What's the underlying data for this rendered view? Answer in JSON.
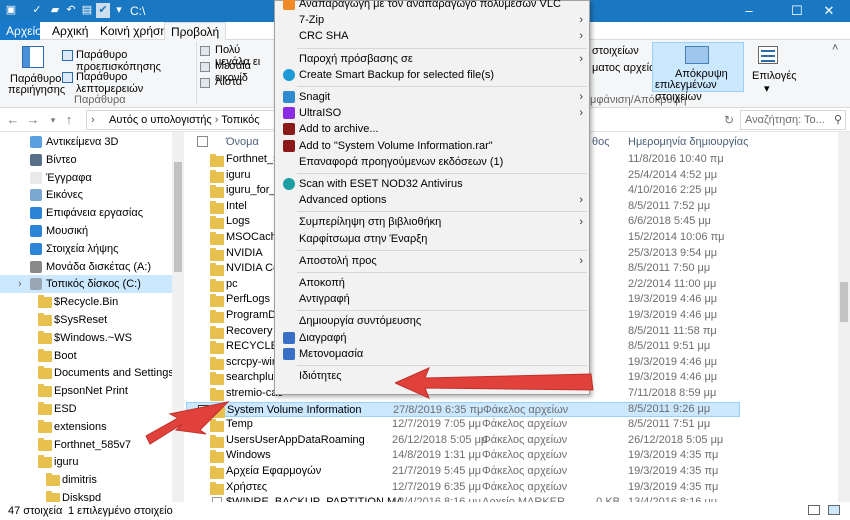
{
  "window": {
    "title": "C:\\",
    "controls": {
      "minimize": "–",
      "maximize": "☐",
      "close": "✕"
    }
  },
  "ribbon_tabs": [
    "Αρχείο",
    "Αρχική",
    "Κοινή χρήση",
    "Προβολή"
  ],
  "ribbon": {
    "preview_pane": "Παράθυρο",
    "preview_pane_2": "περιήγησης",
    "preview_button": "Παράθυρο προεπισκόπησης",
    "details_button": "Παράθυρο λεπτομερειών",
    "group_panes": "Παράθυρα",
    "large_icons": "Πολύ μεγάλα ει",
    "medium_icons": "Μεσαία εικονίδ",
    "list": "Λίστα",
    "right_top": "στοιχείων",
    "right_mid": "ματος αρχείων",
    "group_showhide": "μφάνιση/Απόκρυψη",
    "hide_selected": "Απόκρυψη",
    "hide_selected_2": "επιλεγμένων στοιχείων",
    "options": "Επιλογές"
  },
  "nav": {
    "breadcrumb_1": "Αυτός ο υπολογιστής",
    "breadcrumb_2": "Τοπικός δίσκος",
    "search_placeholder": "Αναζήτηση: Το..."
  },
  "nav_pane": [
    {
      "label": "Αντικείμενα 3D",
      "icon": "cube-icon",
      "indent": 1
    },
    {
      "label": "Βίντεο",
      "icon": "video-icon",
      "indent": 1
    },
    {
      "label": "Έγγραφα",
      "icon": "document-icon",
      "indent": 1
    },
    {
      "label": "Εικόνες",
      "icon": "pictures-icon",
      "indent": 1
    },
    {
      "label": "Επιφάνεια εργασίας",
      "icon": "desktop-icon",
      "indent": 1
    },
    {
      "label": "Μουσική",
      "icon": "music-icon",
      "indent": 1
    },
    {
      "label": "Στοιχεία λήψης",
      "icon": "download-icon",
      "indent": 1
    },
    {
      "label": "Μονάδα δισκέτας (A:)",
      "icon": "floppy-icon",
      "indent": 1
    },
    {
      "label": "Τοπικός δίσκος (C:)",
      "icon": "drive-icon",
      "indent": 1,
      "selected": true
    },
    {
      "label": "$Recycle.Bin",
      "icon": "folder-icon",
      "indent": 2
    },
    {
      "label": "$SysReset",
      "icon": "folder-icon",
      "indent": 2
    },
    {
      "label": "$Windows.~WS",
      "icon": "folder-icon",
      "indent": 2
    },
    {
      "label": "Boot",
      "icon": "folder-icon",
      "indent": 2
    },
    {
      "label": "Documents and Settings",
      "icon": "folder-icon",
      "indent": 2
    },
    {
      "label": "EpsonNet Print",
      "icon": "folder-icon",
      "indent": 2
    },
    {
      "label": "ESD",
      "icon": "folder-icon",
      "indent": 2
    },
    {
      "label": "extensions",
      "icon": "folder-icon",
      "indent": 2
    },
    {
      "label": "Forthnet_585v7",
      "icon": "folder-icon",
      "indent": 2
    },
    {
      "label": "iguru",
      "icon": "folder-icon",
      "indent": 2
    },
    {
      "label": "dimitris",
      "icon": "folder-icon",
      "indent": 3
    },
    {
      "label": "Diskspd",
      "icon": "folder-icon",
      "indent": 3
    }
  ],
  "columns": {
    "name": "Όνομα",
    "date_fragment": "θος",
    "created": "Ημερομηνία δημιουργίας"
  },
  "files": [
    {
      "name": "Forthnet_5",
      "date": "",
      "type": "",
      "size": "",
      "created": "11/8/2016 10:40 πμ"
    },
    {
      "name": "iguru",
      "date": "",
      "type": "",
      "size": "",
      "created": "25/4/2014 4:52 μμ"
    },
    {
      "name": "iguru_for_e",
      "date": "",
      "type": "",
      "size": "",
      "created": "4/10/2016 2:25 μμ"
    },
    {
      "name": "Intel",
      "date": "",
      "type": "",
      "size": "",
      "created": "8/5/2011 7:52 μμ"
    },
    {
      "name": "Logs",
      "date": "",
      "type": "",
      "size": "",
      "created": "6/6/2018 5:45 μμ"
    },
    {
      "name": "MSOCache",
      "date": "",
      "type": "",
      "size": "",
      "created": "15/2/2014 10:06 πμ"
    },
    {
      "name": "NVIDIA",
      "date": "",
      "type": "",
      "size": "",
      "created": "25/3/2013 9:54 μμ"
    },
    {
      "name": "NVIDIA Corp",
      "date": "",
      "type": "",
      "size": "",
      "created": "8/5/2011 7:50 μμ"
    },
    {
      "name": "pc",
      "date": "",
      "type": "",
      "size": "",
      "created": "2/2/2014 11:00 μμ"
    },
    {
      "name": "PerfLogs",
      "date": "",
      "type": "",
      "size": "",
      "created": "19/3/2019 4:46 μμ"
    },
    {
      "name": "ProgramDat",
      "date": "",
      "type": "",
      "size": "",
      "created": "19/3/2019 4:46 μμ"
    },
    {
      "name": "Recovery",
      "date": "",
      "type": "",
      "size": "",
      "created": "8/5/2011 11:58 πμ"
    },
    {
      "name": "RECYCLER",
      "date": "",
      "type": "",
      "size": "",
      "created": "8/5/2011 9:51 μμ"
    },
    {
      "name": "scrcpy-winc",
      "date": "",
      "type": "",
      "size": "",
      "created": "19/3/2019 4:46 μμ"
    },
    {
      "name": "searchplugi",
      "date": "",
      "type": "",
      "size": "",
      "created": "19/3/2019 4:46 μμ"
    },
    {
      "name": "stremio-cac",
      "date": "",
      "type": "",
      "size": "",
      "created": "7/11/2018 8:59 μμ"
    },
    {
      "name": "System Volume Information",
      "date": "27/8/2019 6:35 πμ",
      "type": "Φάκελος αρχείων",
      "size": "",
      "created": "8/5/2011 9:26 μμ",
      "selected": true
    },
    {
      "name": "Temp",
      "date": "12/7/2019 7:05 μμ",
      "type": "Φάκελος αρχείων",
      "size": "",
      "created": "8/5/2011 7:51 μμ"
    },
    {
      "name": "UsersUserAppDataRoaming",
      "date": "26/12/2018 5:05 μμ",
      "type": "Φάκελος αρχείων",
      "size": "",
      "created": "26/12/2018 5:05 μμ"
    },
    {
      "name": "Windows",
      "date": "14/8/2019 1:31 μμ",
      "type": "Φάκελος αρχείων",
      "size": "",
      "created": "19/3/2019 4:35 πμ"
    },
    {
      "name": "Αρχεία Εφαρμογών",
      "date": "21/7/2019 5:45 μμ",
      "type": "Φάκελος αρχείων",
      "size": "",
      "created": "19/3/2019 4:35 πμ"
    },
    {
      "name": "Χρήστες",
      "date": "12/7/2019 6:35 μμ",
      "type": "Φάκελος αρχείων",
      "size": "",
      "created": "19/3/2019 4:35 πμ"
    },
    {
      "name": "$WINRE_BACKUP_PARTITION.MARKER",
      "date": "13/4/2016 8:16 μμ",
      "type": "Αρχείο MARKER",
      "size": "0 KB",
      "created": "13/4/2016 8:16 μμ"
    }
  ],
  "context_menu": [
    {
      "label": "Αναπαραγωγή με τον αναπαραγωγό πολυμέσων VLC",
      "icon": "vlc-icon"
    },
    {
      "label": "7-Zip",
      "sub": true
    },
    {
      "label": "CRC SHA",
      "sub": true
    },
    {
      "sep": true
    },
    {
      "label": "Παροχή πρόσβασης σε",
      "sub": true
    },
    {
      "label": "Create Smart Backup for selected file(s)",
      "icon": "backup-icon"
    },
    {
      "sep": true
    },
    {
      "label": "Snagit",
      "icon": "snagit-icon",
      "sub": true
    },
    {
      "label": "UltraISO",
      "icon": "ultraiso-icon",
      "sub": true
    },
    {
      "label": "Add to archive...",
      "icon": "winrar-icon"
    },
    {
      "label": "Add to \"System Volume Information.rar\"",
      "icon": "winrar-icon"
    },
    {
      "label": "Επαναφορά προηγούμενων εκδόσεων (1)"
    },
    {
      "sep": true
    },
    {
      "label": "Scan with ESET NOD32 Antivirus",
      "icon": "eset-icon"
    },
    {
      "label": "Advanced options",
      "sub": true
    },
    {
      "sep": true
    },
    {
      "label": "Συμπερίληψη στη βιβλιοθήκη",
      "sub": true
    },
    {
      "label": "Καρφίτσωμα στην Έναρξη"
    },
    {
      "sep": true
    },
    {
      "label": "Αποστολή προς",
      "sub": true
    },
    {
      "sep": true
    },
    {
      "label": "Αποκοπή"
    },
    {
      "label": "Αντιγραφή"
    },
    {
      "sep": true
    },
    {
      "label": "Δημιουργία συντόμευσης"
    },
    {
      "label": "Διαγραφή",
      "icon": "shield-icon"
    },
    {
      "label": "Μετονομασία",
      "icon": "shield-icon"
    },
    {
      "sep": true
    },
    {
      "label": "Ιδιότητες"
    }
  ],
  "status": {
    "count": "47 στοιχεία",
    "selected": "1 επιλεγμένο στοιχείο"
  },
  "colors": {
    "accent": "#1a78c2",
    "selection": "#cce8ff",
    "arrow": "#e0413a",
    "folder": "#e8c04d"
  }
}
